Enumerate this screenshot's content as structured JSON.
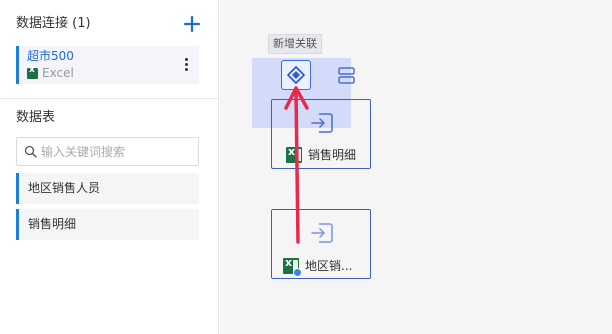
{
  "sidebar": {
    "connections_title": "数据连接 (1)",
    "connection": {
      "name": "超市500",
      "type": "Excel"
    },
    "tables_title": "数据表",
    "search_placeholder": "输入关键词搜索",
    "tables": [
      {
        "label": "地区销售人员"
      },
      {
        "label": "销售明细"
      }
    ]
  },
  "canvas": {
    "tooltip": "新增关联",
    "nodes": [
      {
        "label": "销售明细"
      },
      {
        "label": "地区销..."
      }
    ]
  },
  "colors": {
    "accent": "#1e6ad6",
    "drag_arrow": "#e8294b",
    "excel_green": "#1e7145"
  }
}
